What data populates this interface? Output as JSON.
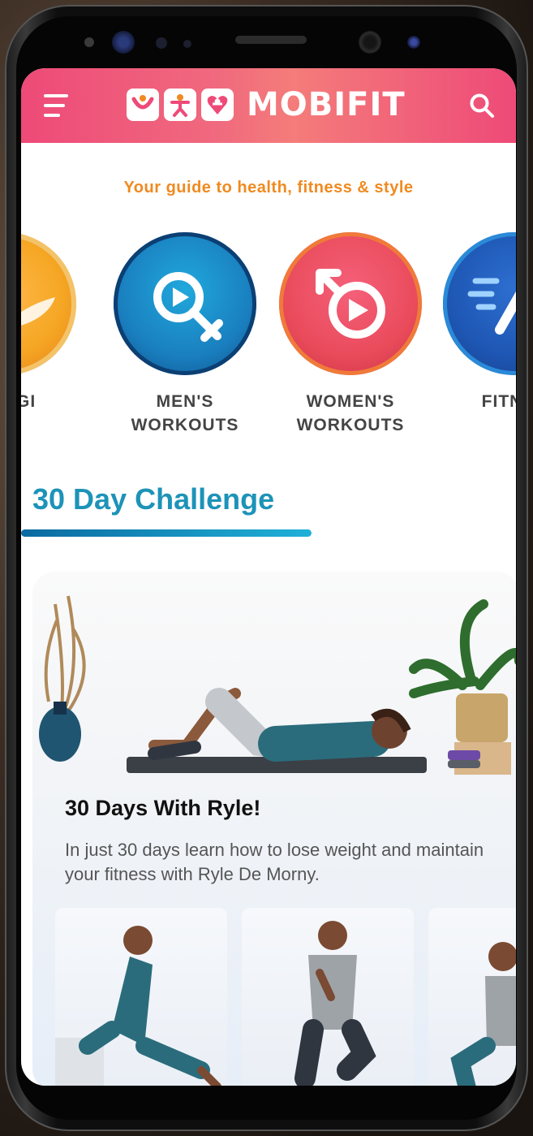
{
  "app": {
    "name": "MOBIFIT",
    "tagline": "Your guide to health, fitness & style"
  },
  "categories": [
    {
      "label_line1": "L YOGI",
      "label_line2": "",
      "icon": "lotus-icon",
      "color": "#f5a623"
    },
    {
      "label_line1": "MEN'S",
      "label_line2": "WORKOUTS",
      "icon": "male-play-icon",
      "color": "#1a7fbf"
    },
    {
      "label_line1": "WOMEN'S",
      "label_line2": "WORKOUTS",
      "icon": "female-play-icon",
      "color": "#e94b5b"
    },
    {
      "label_line1": "FITNES",
      "label_line2": "",
      "icon": "running-lines-icon",
      "color": "#1e56b3"
    }
  ],
  "section": {
    "title": "30 Day Challenge"
  },
  "challenge": {
    "title": "30 Days With Ryle!",
    "description": "In just 30 days learn how to lose weight and maintain your fitness with Ryle De Morny."
  },
  "colors": {
    "brand_pink": "#ee4a78",
    "tagline_orange": "#f08a20",
    "section_blue": "#1d93b8"
  }
}
